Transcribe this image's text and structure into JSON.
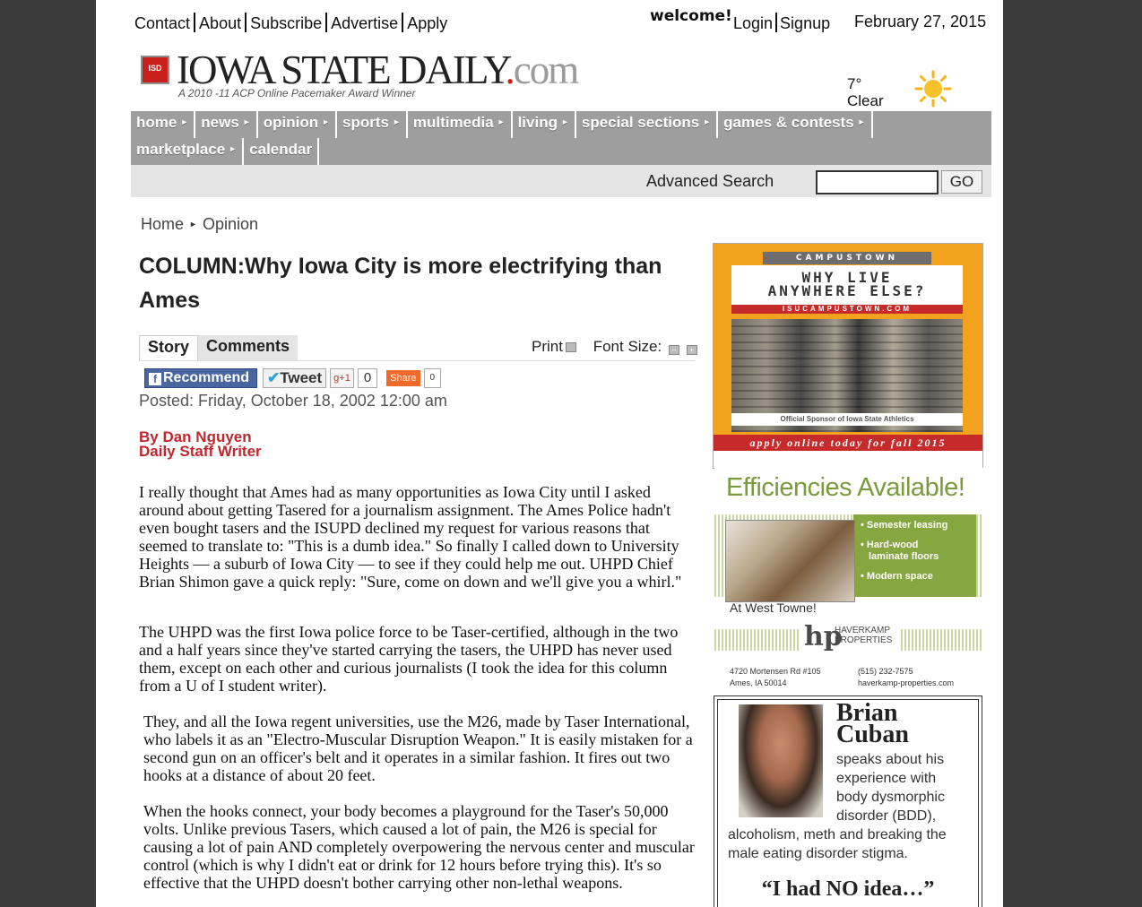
{
  "top_links": [
    "Contact",
    "About",
    "Subscribe",
    "Advertise",
    "Apply"
  ],
  "welcome": "welcome!",
  "auth": {
    "login": "Login",
    "signup": "Signup"
  },
  "date": "February 27, 2015",
  "logo": {
    "badge": "ISD",
    "title_main": "IOWA STATE DAILY",
    "title_dot": ".",
    "title_com": "com",
    "tagline": "A 2010 -11 ACP Online Pacemaker Award Winner"
  },
  "weather": {
    "temp": "7°",
    "condition": "Clear",
    "icon": "sun-icon"
  },
  "nav": {
    "row1": [
      "home",
      "news",
      "opinion",
      "sports",
      "multimedia",
      "living",
      "special sections",
      "games & contests"
    ],
    "row2": [
      "marketplace",
      "calendar"
    ]
  },
  "search": {
    "label": "Advanced Search",
    "value": "",
    "button": "GO"
  },
  "breadcrumb": {
    "home": "Home",
    "current": "Opinion"
  },
  "article": {
    "headline": "COLUMN:Why Iowa City is more electrifying than Ames",
    "tabs": [
      "Story",
      "Comments"
    ],
    "tools": {
      "print": "Print",
      "font_size": "Font Size:"
    },
    "social": {
      "recommend": "Recommend",
      "tweet": "Tweet",
      "gplus": "g+1",
      "gplus_count": "0",
      "share": "Share",
      "share_count": "0"
    },
    "posted": "Posted: Friday, October 18, 2002 12:00 am",
    "byline_name": "By Dan Nguyen",
    "byline_role": "Daily Staff Writer",
    "paragraphs": [
      "I really thought that Ames had as many opportunities as Iowa City until I asked around about getting Tasered for a journalism assignment. The Ames Police hadn't even bought tasers and the ISUPD declined my request for various reasons that seemed to translate to: \"This is a dumb idea.\" So finally I called down to University Heights — a suburb of Iowa City — to see if they could help me out. UHPD Chief Brian Shimon gave a quick reply: \"Sure, come on down and we'll give you a whirl.\"",
      "The UHPD was the first Iowa police force to be Taser-certified, although in the two and a half years since they've started carrying the tasers, the UHPD has never used them, except on each other and curious journalists (I took the idea for this column from a U of I student writer).",
      "They, and all the Iowa regent universities, use the M26, made by Taser International, who labels it as an \"Electro-Muscular Disruption Weapon.\" It is easily mistaken for a second gun on an officer's belt and it operates in a similar fashion. It fires out two hooks at a distance of about 20 feet.",
      "When the hooks connect, your body becomes a playground for the Taser's 50,000 volts. Unlike previous Tasers, which caused a lot of pain, the M26 is special for causing a lot of pain AND completely overpowering the nervous center and muscular control (which is why I didn't eat or drink for 12 hours before trying this). It's so effective that the UHPD doesn't bother carrying other non-lethal weapons."
    ]
  },
  "ads": {
    "campustown": {
      "band": "CAMPUSTOWN",
      "headline_1": "WHY LIVE",
      "headline_2": "ANYWHERE ELSE?",
      "url": "ISUCAMPUSTOWN.COM",
      "sponsor": "Official Sponsor of Iowa State Athletics",
      "cta": "apply online today for fall 2015"
    },
    "haverkamp": {
      "headline": "Efficiencies Available!",
      "features": [
        "• Semester leasing",
        "• Hard-wood",
        "laminate floors",
        "• Modern space"
      ],
      "location": "At West Towne!",
      "brand_mark": "hp",
      "brand_1": "HAVERKAMP",
      "brand_2": "PROPERTIES",
      "address_1": "4720 Mortensen Rd #105",
      "address_2": "Ames, IA 50014",
      "phone": "(515) 232-7575",
      "site": "haverkamp-properties.com"
    },
    "cuban": {
      "first": "Brian",
      "last": "Cuban",
      "desc_1": "speaks about his experience with body dysmorphic disorder (BDD),",
      "desc_2": "alcoholism, meth and breaking the male eating disorder stigma.",
      "quote": "“I had NO idea…”"
    }
  }
}
